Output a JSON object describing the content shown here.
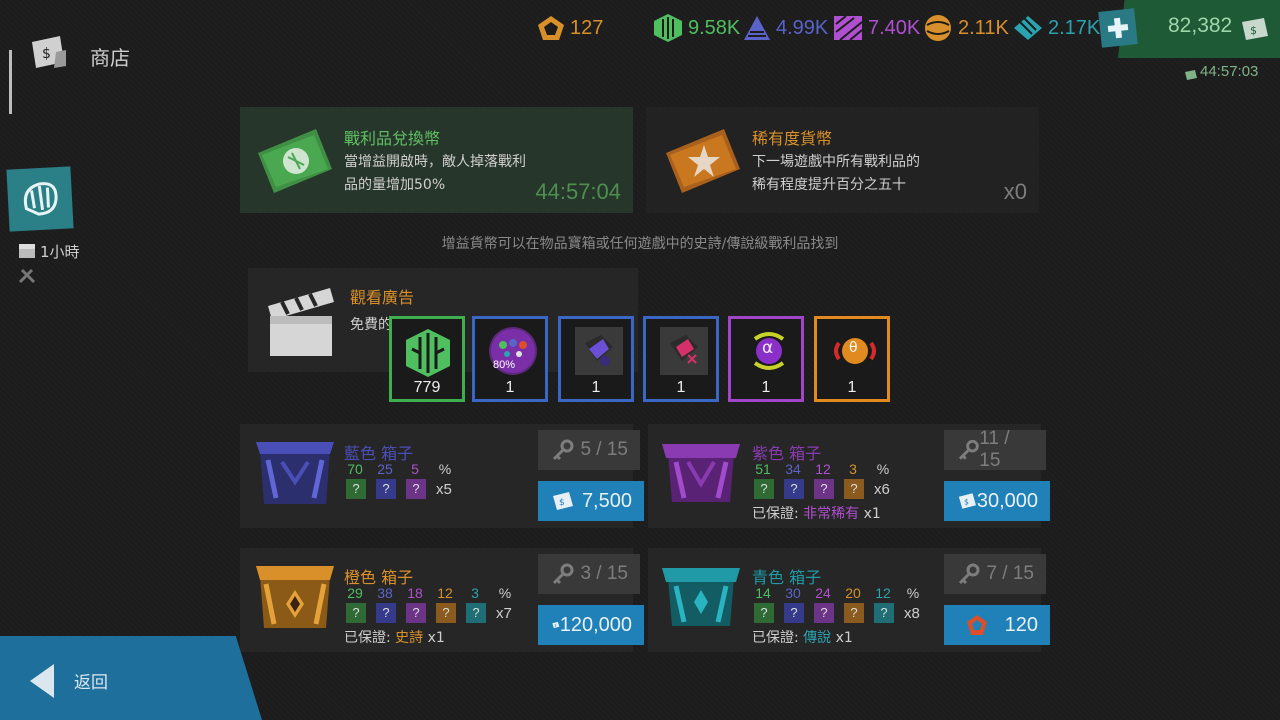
{
  "header": {
    "title": "商店",
    "resources": [
      {
        "name": "pentagon-token",
        "value": "127",
        "color": "#d9902a"
      },
      {
        "name": "green-fragment",
        "value": "9.58K",
        "color": "#4fbf5f"
      },
      {
        "name": "blue-fragment",
        "value": "4.99K",
        "color": "#5a63c9"
      },
      {
        "name": "purple-fragment",
        "value": "7.40K",
        "color": "#b04fcf"
      },
      {
        "name": "orange-fragment",
        "value": "2.11K",
        "color": "#d9902a"
      },
      {
        "name": "teal-fragment",
        "value": "2.17K",
        "color": "#2aa3b0"
      }
    ],
    "money": "82,382",
    "timer": "44:57:03"
  },
  "sidebar": {
    "buff_duration": "1小時"
  },
  "boosters": {
    "loot": {
      "title": "戰利品兌換幣",
      "desc_line1": "當增益開啟時，敵人掉落戰利",
      "desc_line2": "品的量增加50%",
      "timer": "44:57:04"
    },
    "rarity": {
      "title": "稀有度貨幣",
      "desc_line1": "下一場遊戲中所有戰利品的",
      "desc_line2": "稀有程度提升百分之五十",
      "count": "x0"
    },
    "info": "增益貨幣可以在物品寶箱或任何遊戲中的史詩/傳說級戰利品找到"
  },
  "ad": {
    "title": "觀看廣告",
    "desc_visible": "免費的"
  },
  "rewards": [
    {
      "name": "green-fragment",
      "count": "779",
      "border": "#3fae4f"
    },
    {
      "name": "buff-orb",
      "count": "1",
      "border": "#3a66c4",
      "badge": "80%"
    },
    {
      "name": "blue-crystal",
      "count": "1",
      "border": "#3a66c4"
    },
    {
      "name": "pink-crystal",
      "count": "1",
      "border": "#3a66c4"
    },
    {
      "name": "alpha-orb",
      "count": "1",
      "border": "#a245c9",
      "glyph": "α"
    },
    {
      "name": "beta-orb",
      "count": "1",
      "border": "#e08a1f",
      "glyph": "θ"
    }
  ],
  "chests": [
    {
      "id": "blue",
      "name_color": "藍色",
      "name_box": "箱子",
      "color": "#4a4fb8",
      "pcts": [
        "70",
        "25",
        "5"
      ],
      "pct_symbol": "%",
      "mult": "x5",
      "keys": "5 / 15",
      "price": "7,500"
    },
    {
      "id": "purple",
      "name_color": "紫色",
      "name_box": "箱子",
      "color": "#8b3bb2",
      "pcts": [
        "51",
        "34",
        "12",
        "3"
      ],
      "pct_symbol": "%",
      "mult": "x6",
      "guarantee_label": "已保證:",
      "guarantee_value": "非常稀有",
      "guarantee_mult": "x1",
      "keys": "11 / 15",
      "price": "30,000"
    },
    {
      "id": "orange",
      "name_color": "橙色",
      "name_box": "箱子",
      "color": "#d9902a",
      "pcts": [
        "29",
        "38",
        "18",
        "12",
        "3"
      ],
      "pct_symbol": "%",
      "mult": "x7",
      "guarantee_label": "已保證:",
      "guarantee_value": "史詩",
      "guarantee_mult": "x1",
      "keys": "3 / 15",
      "price": "120,000"
    },
    {
      "id": "teal",
      "name_color": "青色",
      "name_box": "箱子",
      "color": "#1f9aa6",
      "pcts": [
        "14",
        "30",
        "24",
        "20",
        "12"
      ],
      "pct_symbol": "%",
      "mult": "x8",
      "guarantee_label": "已保證:",
      "guarantee_value": "傳說",
      "guarantee_mult": "x1",
      "keys": "7 / 15",
      "price": "120"
    }
  ],
  "footer": {
    "back_label": "返回"
  }
}
